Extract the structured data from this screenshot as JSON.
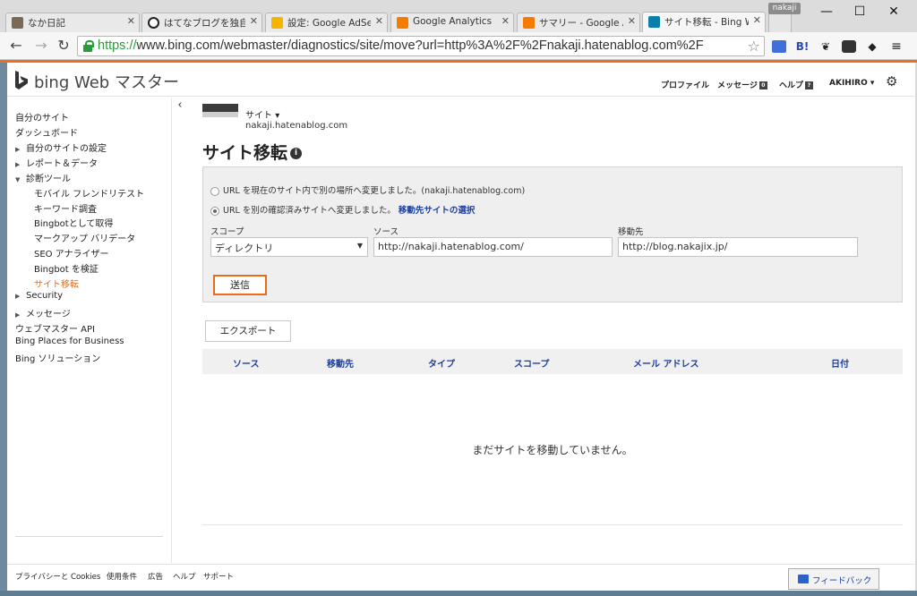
{
  "browser": {
    "tabs": [
      {
        "title": "なか日記",
        "icon_color": "#7a6a55"
      },
      {
        "title": "はてなブログを独自ドメ",
        "icon_color": "#222222"
      },
      {
        "title": "設定: Google AdSens",
        "icon_color": "#f4b400"
      },
      {
        "title": "Google Analytics",
        "icon_color": "#f57c00"
      },
      {
        "title": "サマリー - Google Anal",
        "icon_color": "#f57c00"
      },
      {
        "title": "サイト移転 - Bing Web",
        "icon_color": "#0a7fa8"
      }
    ],
    "profile_badge": "nakaji",
    "url_scheme": "https://",
    "url_rest": "www.bing.com/webmaster/diagnostics/site/move?url=http%3A%2F%2Fnakaji.hatenablog.com%2F",
    "extension_icons": [
      "chat-icon",
      "bookmark-icon",
      "evernote-icon",
      "pocket-icon",
      "layers-icon",
      "menu-icon"
    ]
  },
  "header": {
    "brand": "bing Web マスター",
    "links": {
      "profile": "プロファイル",
      "messages": "メッセージ",
      "messages_count": "0",
      "help": "ヘルプ",
      "help_badge": "?",
      "user": "AKIHIRO"
    }
  },
  "sidebar": {
    "items": [
      {
        "label": "自分のサイト"
      },
      {
        "label": "ダッシュボード"
      },
      {
        "label": "自分のサイトの設定"
      },
      {
        "label": "レポート＆データ"
      },
      {
        "label": "診断ツール"
      },
      {
        "label": "モバイル フレンドリテスト"
      },
      {
        "label": "キーワード調査"
      },
      {
        "label": "Bingbotとして取得"
      },
      {
        "label": "マークアップ バリデータ"
      },
      {
        "label": "SEO アナライザー"
      },
      {
        "label": "Bingbot を検証"
      },
      {
        "label": "サイト移転"
      },
      {
        "label": "Security"
      },
      {
        "label": "メッセージ"
      },
      {
        "label": "ウェブマスター API"
      },
      {
        "label": "Bing Places for Business"
      },
      {
        "label": "Bing ソリューション"
      }
    ]
  },
  "site": {
    "selector_label": "サイト",
    "domain": "nakaji.hatenablog.com"
  },
  "main": {
    "title": "サイト移転",
    "option1": "URL を現在のサイト内で別の場所へ変更しました。(nakaji.hatenablog.com)",
    "option2": "URL を別の確認済みサイトへ変更しました。",
    "option2_link": "移動先サイトの選択",
    "scope_label": "スコープ",
    "scope_value": "ディレクトリ",
    "source_label": "ソース",
    "source_value": "http://nakaji.hatenablog.com/",
    "dest_label": "移動先",
    "dest_value": "http://blog.nakajix.jp/",
    "submit": "送信",
    "export": "エクスポート",
    "columns": [
      "ソース",
      "移動先",
      "タイプ",
      "スコープ",
      "メール アドレス",
      "日付"
    ],
    "empty": "まだサイトを移動していません。"
  },
  "footer": {
    "links": [
      "プライバシーと Cookies",
      "使用条件",
      "広告",
      "ヘルプ",
      "サポート"
    ],
    "feedback": "フィードバック"
  },
  "colors": {
    "accent": "#e86c1a",
    "link": "#1a3fa0",
    "secure": "#2b9a3a"
  }
}
